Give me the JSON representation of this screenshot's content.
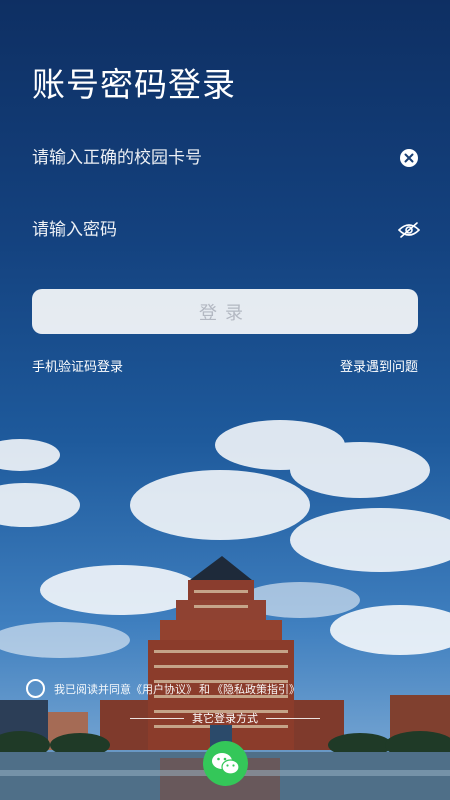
{
  "title": "账号密码登录",
  "card_input": {
    "placeholder": "请输入正确的校园卡号",
    "value": ""
  },
  "password_input": {
    "placeholder": "请输入密码",
    "value": ""
  },
  "login_button": "登录",
  "links": {
    "sms_login": "手机验证码登录",
    "login_problem": "登录遇到问题"
  },
  "agreement": {
    "prefix": "我已阅读并同意",
    "user_agreement": "《用户协议》",
    "and": "和",
    "privacy_policy": "《隐私政策指引》",
    "checked": false
  },
  "other_login_label": "其它登录方式",
  "icons": {
    "clear": "clear-icon",
    "eye_off": "eye-off-icon",
    "wechat": "wechat-icon"
  },
  "colors": {
    "accent": "#34c759",
    "button_bg": "#eef1f6",
    "button_text": "#b3b8c2"
  }
}
